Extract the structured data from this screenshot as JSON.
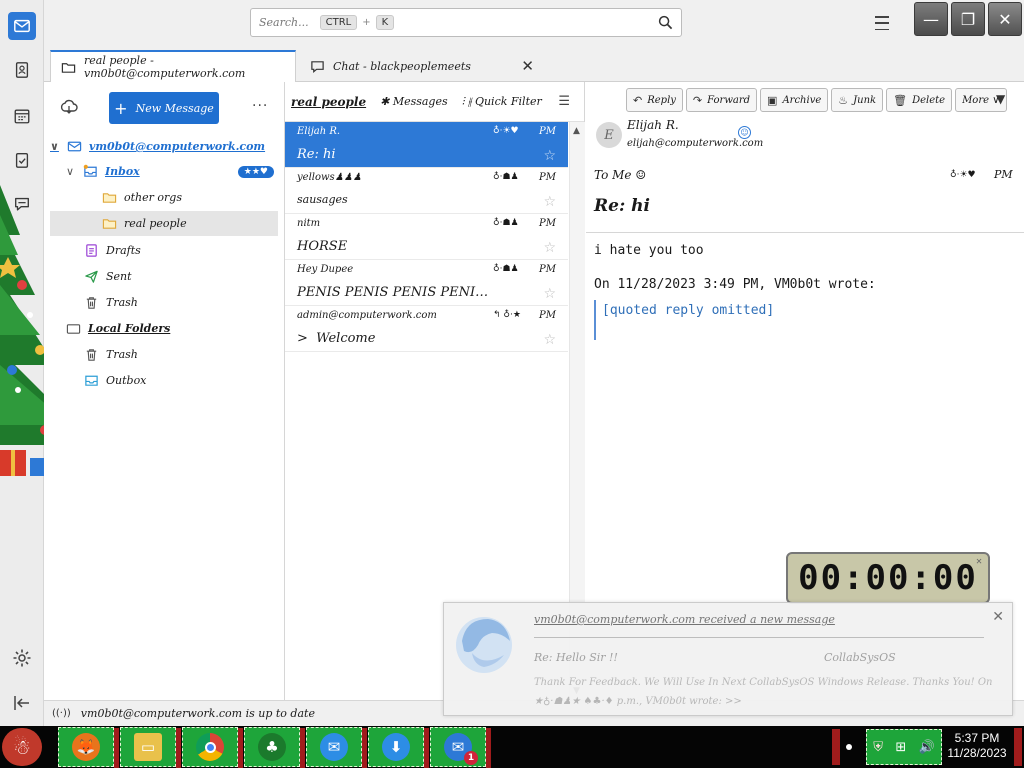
{
  "topbar": {
    "search_placeholder": "Search...",
    "search_key_ctrl": "CTRL",
    "search_key_plus": "+",
    "search_key_k": "K",
    "window_minimize": "—",
    "window_restore": "❐",
    "window_close": "✕"
  },
  "tabs": [
    {
      "label": "real people - vm0b0t@computerwork.com"
    },
    {
      "label": "Chat - blackpeoplemeets",
      "close": "✕"
    }
  ],
  "folder_pane": {
    "new_message_plus": "+",
    "new_message_label": "New Message",
    "more_label": "···",
    "items": [
      {
        "label": "vm0b0t@computerwork.com",
        "twisty": "∨"
      },
      {
        "label": "Inbox",
        "twisty": "∨",
        "badge": "★★♥"
      },
      {
        "label": "other orgs"
      },
      {
        "label": "real people"
      },
      {
        "label": "Drafts"
      },
      {
        "label": "Sent"
      },
      {
        "label": "Trash"
      },
      {
        "label": "Local Folders"
      },
      {
        "label": "Trash"
      },
      {
        "label": "Outbox"
      }
    ]
  },
  "thread_pane": {
    "folder_name": "real people",
    "messages_label": "Messages",
    "quick_filter_label": "Quick Filter",
    "layout_icon": "☰",
    "scroll_up": "▲",
    "scroll_down": "▼",
    "messages": [
      {
        "from": "Elijah R.",
        "icons": "♁·☀♥",
        "time": "PM",
        "subject": "Re: hi",
        "star": "☆"
      },
      {
        "from": "yellows♟♟♟",
        "icons": "♁·☗♟",
        "time": "PM",
        "subject": "sausages",
        "star": "☆"
      },
      {
        "from": "nitm",
        "icons": "♁·☗♟",
        "time": "PM",
        "subject": "HORSE",
        "star": "☆"
      },
      {
        "from": "Hey Dupee",
        "icons": "♁·☗♟",
        "time": "PM",
        "subject": "PENIS PENIS PENIS PENI…",
        "star": "☆"
      },
      {
        "from": "admin@computerwork.com",
        "icons": "↰ ♁·★",
        "time": "PM",
        "subject": "Welcome",
        "twisty": ">",
        "star": "☆"
      }
    ]
  },
  "message_pane": {
    "actions": [
      {
        "icon": "↶",
        "label": "Reply"
      },
      {
        "icon": "↷",
        "label": "Forward"
      },
      {
        "icon": "▣",
        "label": "Archive"
      },
      {
        "icon": "♨",
        "label": "Junk"
      },
      {
        "icon": "🗑",
        "label": "Delete"
      },
      {
        "icon": "",
        "label": "More ∨"
      }
    ],
    "more_arrow": "▼",
    "avatar_initial": "E",
    "sender_name": "Elijah R.",
    "sender_email": "elijah@computerwork.com",
    "contact_icon": "☺",
    "to_line": "To   Me ☺",
    "header_icons": "♁·☀♥",
    "header_time": "PM",
    "subject": "Re: hi",
    "body_line1": "i hate you too",
    "quote_header": "On 11/28/2023 3:49 PM, VM0b0t wrote:",
    "quote_text": "[quoted reply omitted]"
  },
  "status_bar": {
    "signal_icon": "((·))",
    "text": "vm0b0t@computerwork.com is up to date"
  },
  "timer": {
    "value": "00:00:00",
    "close": "✕"
  },
  "notification": {
    "title": "vm0b0t@computerwork.com received a new message",
    "close": "✕",
    "subject": "Re: Hello Sir !!",
    "sender": "CollabSysOS",
    "preview": "Thank For Feedback. We Will Use In Next CollabSysOS Windows Release. Thanks You! On ★♁·☗♟★ ♠♣·♦ p.m., VM0b0t wrote: >>"
  },
  "taskbar": {
    "start_glyph": "☃",
    "apps": [
      {
        "name": "firefox",
        "glyph": "🦊",
        "color": "#e8741c"
      },
      {
        "name": "file-explorer",
        "glyph": "▭",
        "color": "#e9c14b"
      },
      {
        "name": "chrome",
        "glyph": "●",
        "color": "#2a8df0"
      },
      {
        "name": "christmas-tree",
        "glyph": "♣",
        "color": "#1b7a2c"
      },
      {
        "name": "chat",
        "glyph": "✉",
        "color": "#2d8de5"
      },
      {
        "name": "download",
        "glyph": "⬇",
        "color": "#2d8de5"
      },
      {
        "name": "thunderbird",
        "glyph": "✉",
        "color": "#2d79d6",
        "badge": "1"
      }
    ],
    "clock_time": "5:37 PM",
    "clock_date": "11/28/2023"
  },
  "colors": {
    "accent": "#2d79d6",
    "button_blue": "#1f6fd0",
    "taskbar_green": "#1ea53a",
    "taskbar_red": "#a01c1c"
  }
}
